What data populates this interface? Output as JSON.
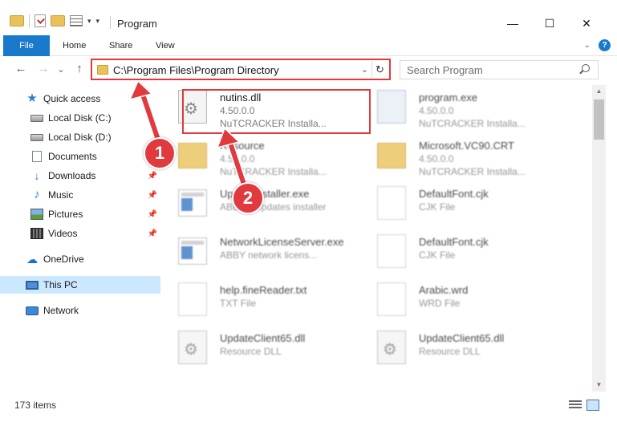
{
  "window": {
    "title": "Program",
    "controls": {
      "minimize": "—",
      "maximize": "☐",
      "close": "✕"
    }
  },
  "ribbon": {
    "tabs": [
      {
        "label": "File"
      },
      {
        "label": "Home"
      },
      {
        "label": "Share"
      },
      {
        "label": "View"
      }
    ],
    "help_label": "?"
  },
  "navigation": {
    "back": "←",
    "forward": "→",
    "recent": "⌄",
    "up": "↑",
    "address_path": "C:\\Program Files\\Program Directory",
    "refresh": "↻",
    "search_placeholder": "Search Program"
  },
  "sidebar": {
    "items": [
      {
        "label": "Quick access",
        "icon": "star-icon"
      },
      {
        "label": "Local Disk (C:)",
        "icon": "disk-icon"
      },
      {
        "label": "Local Disk (D:)",
        "icon": "disk-icon"
      },
      {
        "label": "Documents",
        "icon": "documents-icon"
      },
      {
        "label": "Downloads",
        "icon": "downloads-icon",
        "pinned": true
      },
      {
        "label": "Music",
        "icon": "music-icon",
        "pinned": true
      },
      {
        "label": "Pictures",
        "icon": "pictures-icon",
        "pinned": true
      },
      {
        "label": "Videos",
        "icon": "videos-icon",
        "pinned": true
      },
      {
        "label": "OneDrive",
        "icon": "cloud-icon"
      },
      {
        "label": "This PC",
        "icon": "pc-icon",
        "selected": true
      },
      {
        "label": "Network",
        "icon": "network-icon"
      }
    ]
  },
  "files": [
    {
      "name": "nutins.dll",
      "line1": "4.50.0.0",
      "line2": "NuTCRACKER Installa...",
      "icon": "dll-file-icon"
    },
    {
      "name": "program.exe",
      "line1": "4.50.0.0",
      "line2": "NuTCRACKER Installa...",
      "icon": "installer-file-icon"
    },
    {
      "name": "Resource",
      "line1": "4.50.0.0",
      "line2": "NuTCRACKER Installa...",
      "icon": "folder-file-icon"
    },
    {
      "name": "Microsoft.VC90.CRT",
      "line1": "4.50.0.0",
      "line2": "NuTCRACKER Installa...",
      "icon": "folder-file-icon"
    },
    {
      "name": "UpdateInstaller.exe",
      "line1": "ABBYY Updates installer",
      "line2": "",
      "icon": "exe-file-icon"
    },
    {
      "name": "DefaultFont.cjk",
      "line1": "CJK File",
      "line2": "",
      "icon": "text-file-icon"
    },
    {
      "name": "NetworkLicenseServer.exe",
      "line1": "ABBY network licens...",
      "line2": "",
      "icon": "exe-file-icon"
    },
    {
      "name": "DefaultFont.cjk",
      "line1": "CJK File",
      "line2": "",
      "icon": "text-file-icon"
    },
    {
      "name": "help.fineReader.txt",
      "line1": "TXT File",
      "line2": "",
      "icon": "text-file-icon"
    },
    {
      "name": "Arabic.wrd",
      "line1": "WRD File",
      "line2": "",
      "icon": "text-file-icon"
    },
    {
      "name": "UpdateClient65.dll",
      "line1": "Resource DLL",
      "line2": "",
      "icon": "dll-file-icon"
    },
    {
      "name": "UpdateClient65.dll",
      "line1": "Resource DLL",
      "line2": "",
      "icon": "dll-file-icon"
    }
  ],
  "status": {
    "item_count": "173 items"
  },
  "annotations": {
    "step1": "1",
    "step2": "2"
  },
  "colors": {
    "accent": "#1979ca",
    "highlight": "#e0393e",
    "selected": "#cce8ff",
    "folder": "#e9c25a"
  }
}
